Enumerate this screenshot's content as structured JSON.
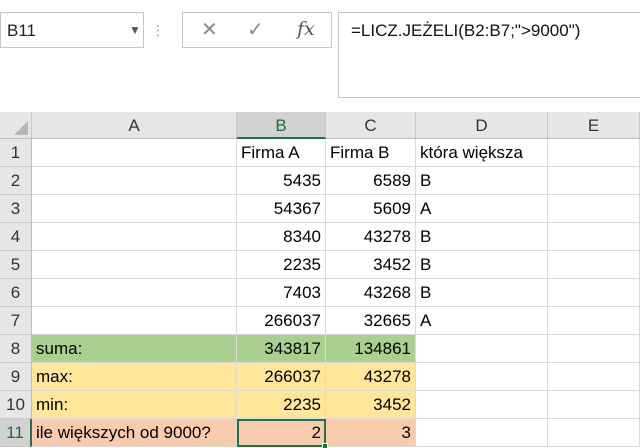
{
  "name_box": {
    "value": "B11"
  },
  "formula_bar": {
    "cancel_icon": "close-icon",
    "enter_icon": "check-icon",
    "fx_label": "fx",
    "formula": "=LICZ.JEŻELI(B2:B7;\">9000\")"
  },
  "colors": {
    "green_row": "#a9d08e",
    "yellow_row": "#ffe699",
    "orange_row": "#f8cbad",
    "accent": "#217346"
  },
  "sheet": {
    "selected_cell": "B11",
    "columns": [
      "A",
      "B",
      "C",
      "D",
      "E"
    ],
    "rows": [
      "1",
      "2",
      "3",
      "4",
      "5",
      "6",
      "7",
      "8",
      "9",
      "10",
      "11"
    ],
    "cells": [
      [
        "",
        "Firma A",
        "Firma B",
        "która większa",
        ""
      ],
      [
        "",
        "5435",
        "6589",
        "B",
        ""
      ],
      [
        "",
        "54367",
        "5609",
        "A",
        ""
      ],
      [
        "",
        "8340",
        "43278",
        "B",
        ""
      ],
      [
        "",
        "2235",
        "3452",
        "B",
        ""
      ],
      [
        "",
        "7403",
        "43268",
        "B",
        ""
      ],
      [
        "",
        "266037",
        "32665",
        "A",
        ""
      ],
      [
        "suma:",
        "343817",
        "134861",
        "",
        ""
      ],
      [
        "max:",
        "266037",
        "43278",
        "",
        ""
      ],
      [
        "min:",
        "2235",
        "3452",
        "",
        ""
      ],
      [
        "ile większych od 9000?",
        "2",
        "3",
        "",
        ""
      ]
    ]
  }
}
